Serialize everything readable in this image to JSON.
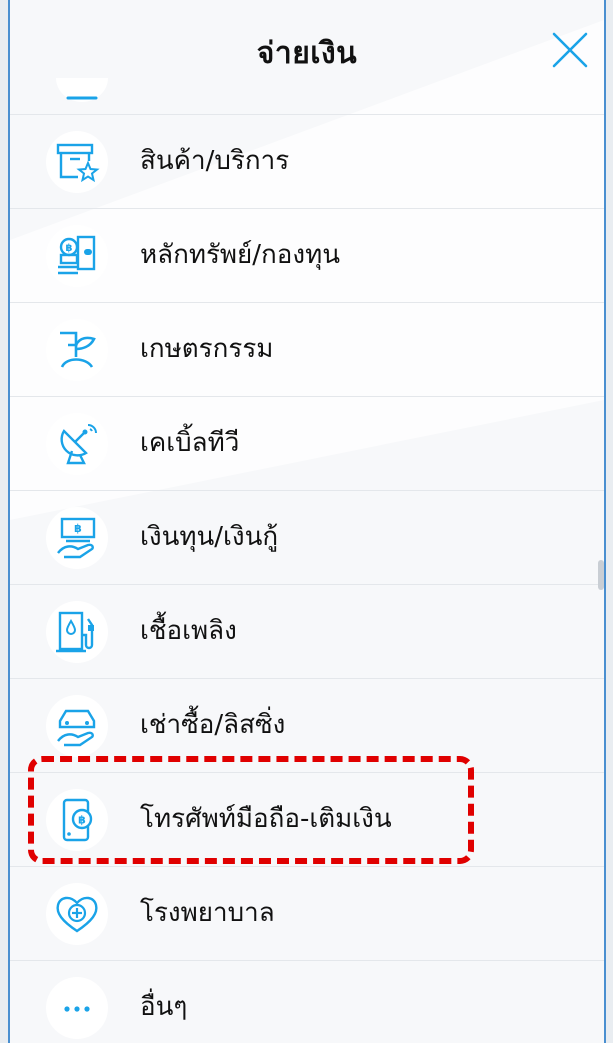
{
  "header": {
    "title": "จ่ายเงิน",
    "close_icon": "close-icon"
  },
  "colors": {
    "icon_blue": "#1aa3e8",
    "highlight_red": "#e00000",
    "border_blue": "#4a8fd0"
  },
  "items": [
    {
      "label": "สินค้า/บริการ",
      "icon": "shop-star-icon"
    },
    {
      "label": "หลักทรัพย์/กองทุน",
      "icon": "securities-icon"
    },
    {
      "label": "เกษตรกรรม",
      "icon": "plant-icon"
    },
    {
      "label": "เคเบิ้ลทีวี",
      "icon": "satellite-dish-icon"
    },
    {
      "label": "เงินทุน/เงินกู้",
      "icon": "loan-hand-icon"
    },
    {
      "label": "เชื้อเพลิง",
      "icon": "fuel-pump-icon"
    },
    {
      "label": "เช่าซื้อ/ลิสซิ่ง",
      "icon": "car-hand-icon"
    },
    {
      "label": "โทรศัพท์มือถือ-เติมเงิน",
      "icon": "mobile-topup-icon",
      "highlighted": true
    },
    {
      "label": "โรงพยาบาล",
      "icon": "heart-plus-icon"
    },
    {
      "label": "อื่นๆ",
      "icon": "more-dots-icon"
    }
  ]
}
